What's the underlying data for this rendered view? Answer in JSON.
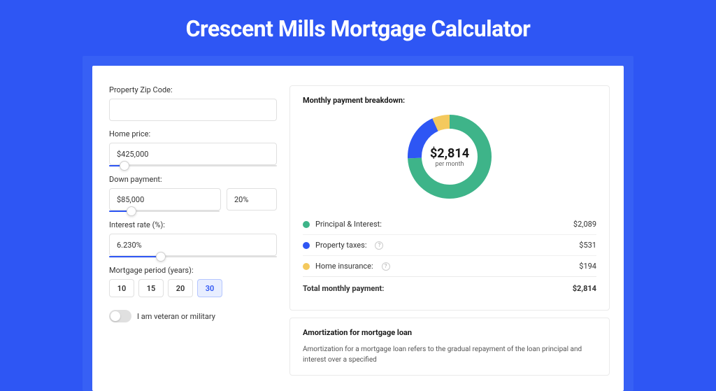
{
  "title": "Crescent Mills Mortgage Calculator",
  "colors": {
    "accent": "#2e56f4",
    "pi": "#3eb489",
    "tax": "#2e56f4",
    "ins": "#f4c95d"
  },
  "form": {
    "zip_label": "Property Zip Code:",
    "zip_value": "",
    "price_label": "Home price:",
    "price_value": "$425,000",
    "price_slider_pct": 9,
    "down_label": "Down payment:",
    "down_value": "$85,000",
    "down_pct_value": "20%",
    "down_slider_pct": 20,
    "rate_label": "Interest rate (%):",
    "rate_value": "6.230%",
    "rate_slider_pct": 31,
    "period_label": "Mortgage period (years):",
    "periods": [
      "10",
      "15",
      "20",
      "30"
    ],
    "selected_period": "30",
    "veteran_label": "I am veteran or military",
    "veteran_on": false
  },
  "breakdown": {
    "title": "Monthly payment breakdown:",
    "center_value": "$2,814",
    "center_sub": "per month",
    "items": [
      {
        "label": "Principal & Interest:",
        "value": "$2,089",
        "color": "#3eb489",
        "info": false
      },
      {
        "label": "Property taxes:",
        "value": "$531",
        "color": "#2e56f4",
        "info": true
      },
      {
        "label": "Home insurance:",
        "value": "$194",
        "color": "#f4c95d",
        "info": true
      }
    ],
    "total_label": "Total monthly payment:",
    "total_value": "$2,814"
  },
  "amort": {
    "title": "Amortization for mortgage loan",
    "text": "Amortization for a mortgage loan refers to the gradual repayment of the loan principal and interest over a specified"
  },
  "chart_data": {
    "type": "pie",
    "title": "Monthly payment breakdown",
    "series": [
      {
        "name": "Principal & Interest",
        "value": 2089,
        "color": "#3eb489"
      },
      {
        "name": "Property taxes",
        "value": 531,
        "color": "#2e56f4"
      },
      {
        "name": "Home insurance",
        "value": 194,
        "color": "#f4c95d"
      }
    ],
    "total": 2814,
    "center_label": "$2,814 per month"
  }
}
